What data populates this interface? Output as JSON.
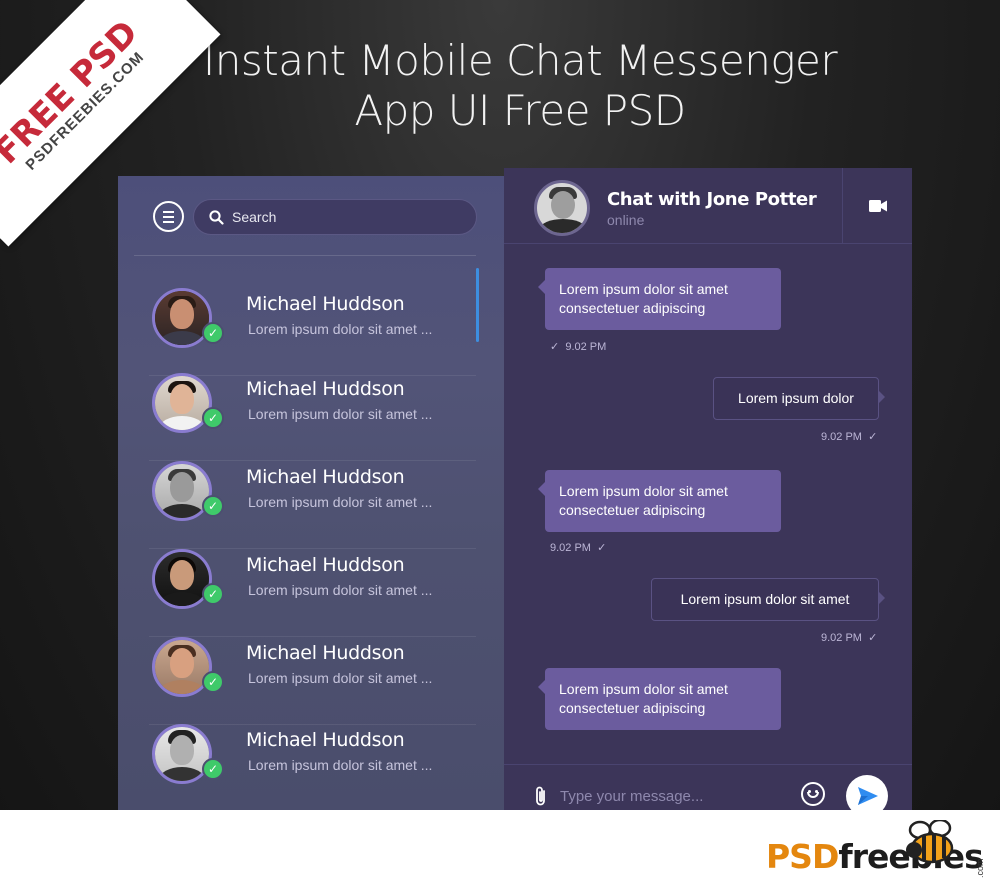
{
  "page": {
    "headline_line1": "Instant Mobile Chat Messenger",
    "headline_line2": "App UI Free PSD"
  },
  "ribbon": {
    "big": "FREE PSD",
    "small": "PSDFREEBIES.COM"
  },
  "sidebar": {
    "search_placeholder": "Search",
    "contacts": [
      {
        "name": "Michael Huddson",
        "preview": "Lorem ipsum dolor sit amet ...",
        "online": true,
        "active": true
      },
      {
        "name": "Michael Huddson",
        "preview": "Lorem ipsum dolor sit amet ...",
        "online": true
      },
      {
        "name": "Michael Huddson",
        "preview": "Lorem ipsum dolor sit amet ...",
        "online": true
      },
      {
        "name": "Michael Huddson",
        "preview": "Lorem ipsum dolor sit amet ...",
        "online": true
      },
      {
        "name": "Michael Huddson",
        "preview": "Lorem ipsum dolor sit amet ...",
        "online": true
      },
      {
        "name": "Michael Huddson",
        "preview": "Lorem ipsum dolor sit amet ...",
        "online": true
      }
    ]
  },
  "chat": {
    "title": "Chat with Jone Potter",
    "status": "online",
    "messages": [
      {
        "direction": "in",
        "line1": "Lorem ipsum dolor sit amet",
        "line2": "consectetuer adipiscing",
        "time": "9.02 PM"
      },
      {
        "direction": "out",
        "line1": "Lorem ipsum dolor",
        "time": "9.02 PM"
      },
      {
        "direction": "in",
        "line1": "Lorem ipsum dolor sit amet",
        "line2": "consectetuer adipiscing",
        "time": "9.02 PM"
      },
      {
        "direction": "out",
        "line1": "Lorem ipsum dolor sit amet",
        "time": "9.02 PM"
      },
      {
        "direction": "in",
        "line1": "Lorem ipsum dolor sit amet",
        "line2": "consectetuer adipiscing"
      }
    ],
    "composer_placeholder": "Type your message..."
  },
  "footer": {
    "logo_part1": "PSD",
    "logo_part2": "freebies",
    "logo_suffix": ".com"
  },
  "colors": {
    "accent_blue": "#3d8ee0",
    "online_green": "#3fca6a",
    "bubble_incoming": "#6b5c9e",
    "logo_orange": "#e4870f"
  },
  "icons": [
    "menu-icon",
    "search-icon",
    "check-icon",
    "video-camera-icon",
    "paperclip-icon",
    "emoji-icon",
    "send-icon"
  ]
}
